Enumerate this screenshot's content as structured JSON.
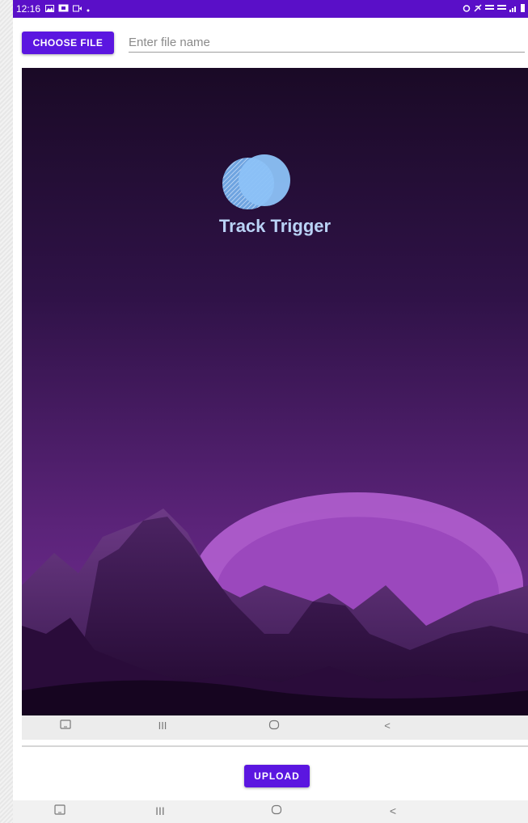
{
  "status_bar": {
    "time": "12:16",
    "left_icons": [
      "gallery-icon",
      "screen-share-icon",
      "video-icon",
      "dot-icon"
    ],
    "right_icons": [
      "alarm-icon",
      "mute-icon",
      "volte-icon",
      "lte-icon",
      "signal-icon",
      "battery-icon"
    ],
    "background": "#5a0fc8"
  },
  "toolbar": {
    "choose_file_label": "CHOOSE FILE",
    "file_name_placeholder": "Enter file name",
    "file_name_value": ""
  },
  "preview": {
    "app_name": "Track Trigger",
    "logo_icon": "overlapping-circles-logo",
    "background_top": "#1a0a26",
    "background_bottom": "#6a2a8e"
  },
  "inner_nav": {
    "items": [
      "screenshot-icon",
      "recents-icon",
      "home-icon",
      "back-icon"
    ],
    "recents_glyph": "III",
    "back_glyph": "<"
  },
  "actions": {
    "upload_label": "UPLOAD",
    "accent": "#5b16e0"
  },
  "system_nav": {
    "items": [
      "screenshot-icon",
      "recents-icon",
      "home-icon",
      "back-icon"
    ],
    "recents_glyph": "III",
    "back_glyph": "<"
  }
}
